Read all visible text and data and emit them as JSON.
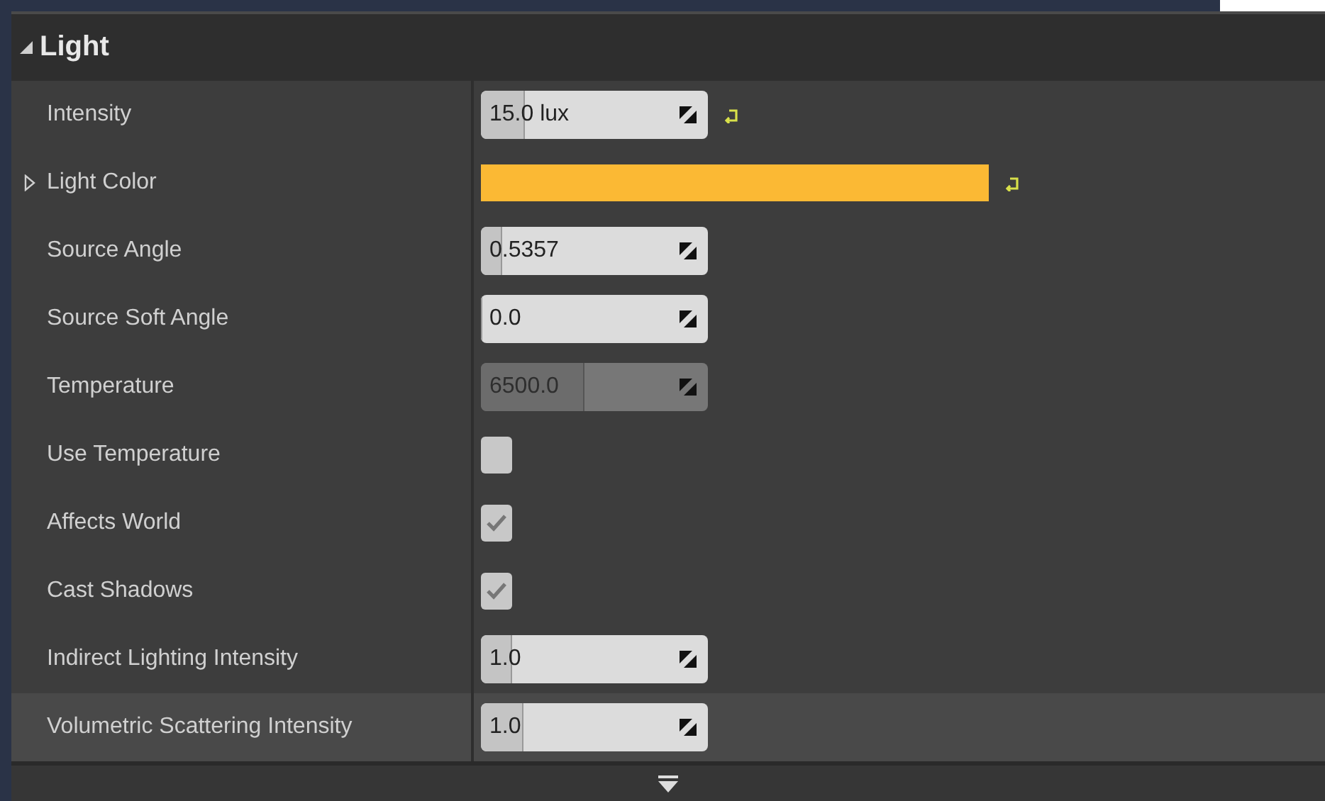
{
  "section": {
    "title": "Light",
    "expanded": true
  },
  "properties": [
    {
      "label": "Intensity",
      "kind": "number",
      "value": "15.0 lux",
      "level": 0.19,
      "disabled": false,
      "modified": true,
      "highlighted": false
    },
    {
      "label": "Light Color",
      "kind": "color",
      "color": "#fbb934",
      "expanded": false,
      "modified": true,
      "highlighted": false
    },
    {
      "label": "Source Angle",
      "kind": "number",
      "value": "0.5357",
      "level": 0.09,
      "disabled": false,
      "modified": false,
      "highlighted": false
    },
    {
      "label": "Source Soft Angle",
      "kind": "number",
      "value": "0.0",
      "level": 0,
      "disabled": false,
      "modified": false,
      "highlighted": false
    },
    {
      "label": "Temperature",
      "kind": "number",
      "value": "6500.0",
      "level": 0.45,
      "disabled": true,
      "modified": false,
      "highlighted": false
    },
    {
      "label": "Use Temperature",
      "kind": "checkbox",
      "checked": false,
      "modified": false,
      "highlighted": false
    },
    {
      "label": "Affects World",
      "kind": "checkbox",
      "checked": true,
      "modified": false,
      "highlighted": false
    },
    {
      "label": "Cast Shadows",
      "kind": "checkbox",
      "checked": true,
      "modified": false,
      "highlighted": false
    },
    {
      "label": "Indirect Lighting Intensity",
      "kind": "number",
      "value": "1.0",
      "level": 0.13,
      "disabled": false,
      "modified": false,
      "highlighted": false
    },
    {
      "label": "Volumetric Scattering Intensity",
      "kind": "number",
      "value": "1.0",
      "level": 0.18,
      "disabled": false,
      "modified": false,
      "highlighted": true
    }
  ]
}
